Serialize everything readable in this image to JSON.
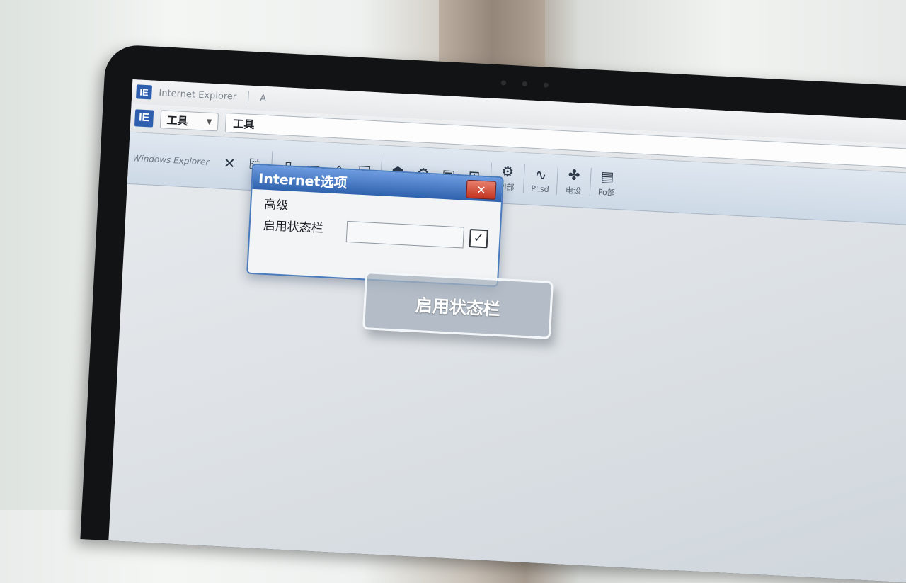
{
  "window": {
    "logo": "IE",
    "title": "Internet Explorer",
    "extra": "A"
  },
  "menu": {
    "logo": "IE",
    "dropdown": "工具",
    "address": "工具"
  },
  "toolbar": {
    "label": "Windows Explorer",
    "buttons": [
      {
        "name": "cut-icon",
        "glyph": "✕",
        "caption": ""
      },
      {
        "name": "paste-icon",
        "glyph": "⎘",
        "caption": ""
      },
      {
        "name": "page-icon",
        "glyph": "▯",
        "caption": ""
      },
      {
        "name": "comment-icon",
        "glyph": "▭",
        "caption": ""
      },
      {
        "name": "home-icon",
        "glyph": "⌂",
        "caption": ""
      },
      {
        "name": "window-icon",
        "glyph": "◱",
        "caption": ""
      },
      {
        "name": "package-icon",
        "glyph": "⬢",
        "caption": ""
      },
      {
        "name": "settings-icon",
        "glyph": "⚙",
        "caption": ""
      },
      {
        "name": "frame-icon",
        "glyph": "▣",
        "caption": ""
      },
      {
        "name": "grid-icon",
        "glyph": "⊞",
        "caption": ""
      },
      {
        "name": "gear-icon",
        "glyph": "⚙",
        "caption": "PI部"
      },
      {
        "name": "chart-icon",
        "glyph": "∿",
        "caption": "PLsd"
      },
      {
        "name": "tools-icon",
        "glyph": "✤",
        "caption": "电设"
      },
      {
        "name": "print-icon",
        "glyph": "▤",
        "caption": "Po部"
      }
    ]
  },
  "dialog": {
    "title": "Internet选项",
    "close_glyph": "✕",
    "section": "高级",
    "option": "启用状态栏",
    "checkbox_glyph": "✓",
    "checked": true
  },
  "tooltip": {
    "text": "启用状态栏"
  }
}
